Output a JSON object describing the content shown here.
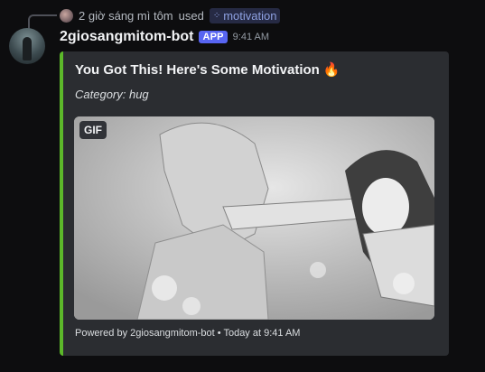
{
  "reply": {
    "user": "2 giờ sáng mì tôm",
    "used_text": "used",
    "command": "motivation"
  },
  "message": {
    "username": "2giosangmitom-bot",
    "badge": "APP",
    "time": "9:41 AM"
  },
  "embed": {
    "accent_color": "#5cb82a",
    "title": "You Got This! Here's Some Motivation",
    "title_emoji": "🔥",
    "description": "Category: hug",
    "gif_badge": "GIF",
    "footer": "Powered by 2giosangmitom-bot • Today at 9:41 AM"
  }
}
